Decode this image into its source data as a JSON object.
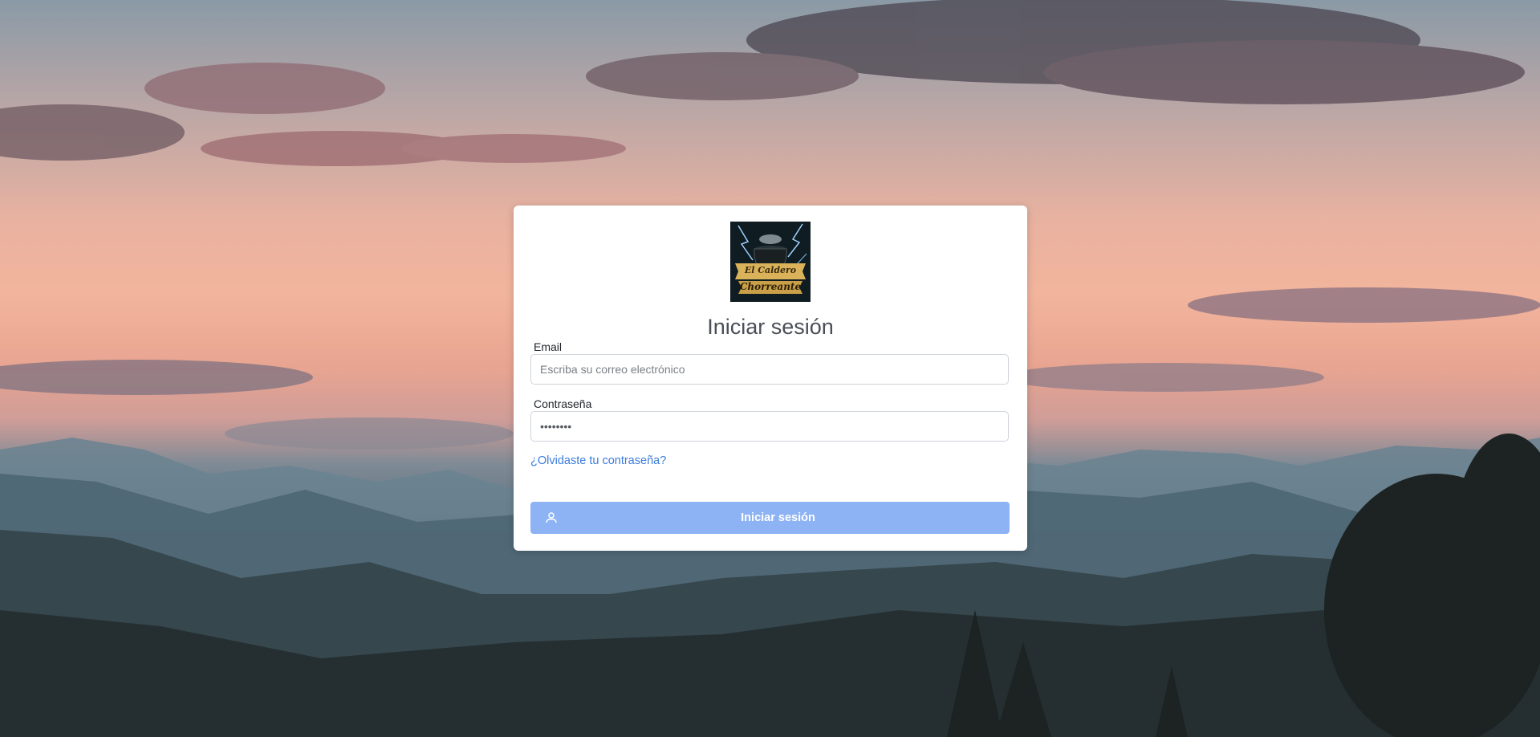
{
  "logo": {
    "line1": "El Caldero",
    "line2": "Chorreante"
  },
  "login": {
    "title": "Iniciar sesión",
    "email_label": "Email",
    "email_placeholder": "Escriba su correo electrónico",
    "password_label": "Contraseña",
    "password_value": "password",
    "forgot_link": "¿Olvidaste tu contraseña?",
    "submit_label": "Iniciar sesión"
  },
  "colors": {
    "accent_button": "#8db3f4",
    "link": "#3b7ddd"
  },
  "icons": {
    "submit": "user-icon"
  }
}
